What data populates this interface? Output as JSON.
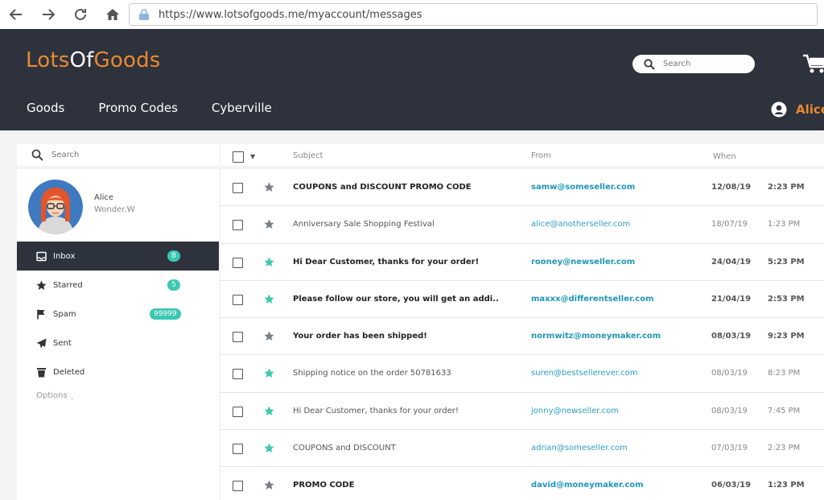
{
  "browser": {
    "url": "https://www.lotsofgoods.me/myaccount/messages"
  },
  "site": {
    "logo_part1": "Lots",
    "logo_part2": "Of",
    "logo_part3": "Goods",
    "search_placeholder": "Search",
    "nav": [
      "Goods",
      "Promo Codes",
      "Cyberville"
    ],
    "user_name": "Alice",
    "logo_color_orange": "#ea8a2f",
    "logo_color_white": "#ffffff"
  },
  "sidebar": {
    "search_placeholder": "Search",
    "profile_name": "Alice",
    "profile_sub": "Wonder.W",
    "folders": [
      {
        "label": "Inbox",
        "icon": "inbox-icon",
        "badge": "8",
        "active": true
      },
      {
        "label": "Starred",
        "icon": "star-icon",
        "badge": "5",
        "active": false
      },
      {
        "label": "Spam",
        "icon": "flag-icon",
        "badge": "99999",
        "active": false
      },
      {
        "label": "Sent",
        "icon": "paper-plane-icon",
        "badge": "",
        "active": false
      },
      {
        "label": "Deleted",
        "icon": "trash-icon",
        "badge": "",
        "active": false
      }
    ],
    "options_label": "Options ˏ"
  },
  "list": {
    "headers": {
      "subject": "Subject",
      "from": "From",
      "when": "When"
    },
    "messages": [
      {
        "subject": "COUPONS and DISCOUNT PROMO CODE",
        "from": "samw@someseller.com",
        "date": "12/08/19",
        "time": "2:23 PM",
        "unread": true,
        "starred": false
      },
      {
        "subject": "Anniversary Sale Shopping Festival",
        "from": "alice@anotherseller.com",
        "date": "18/07/19",
        "time": "1:23 PM",
        "unread": false,
        "starred": false
      },
      {
        "subject": "Hi Dear Customer, thanks for your order!",
        "from": "rooney@newseller.com",
        "date": "24/04/19",
        "time": "5:23 PM",
        "unread": true,
        "starred": true
      },
      {
        "subject": "Please follow our store, you will get an addi..",
        "from": "maxxx@differentseller.com",
        "date": "21/04/19",
        "time": "2:53 PM",
        "unread": true,
        "starred": true
      },
      {
        "subject": "Your order has been shipped!",
        "from": "normwitz@moneymaker.com",
        "date": "08/03/19",
        "time": "9:23 PM",
        "unread": true,
        "starred": false
      },
      {
        "subject": "Shipping notice on the order 50781633",
        "from": "suren@bestsellerever.com",
        "date": "08/03/19",
        "time": "8:23 PM",
        "unread": false,
        "starred": true
      },
      {
        "subject": "Hi Dear Customer, thanks for your order!",
        "from": "jonny@newseller.com",
        "date": "08/03/19",
        "time": "7:45 PM",
        "unread": false,
        "starred": true
      },
      {
        "subject": "COUPONS and DISCOUNT",
        "from": "adrian@someseller.com",
        "date": "07/03/19",
        "time": "2:23 PM",
        "unread": false,
        "starred": true
      },
      {
        "subject": "PROMO CODE",
        "from": "david@moneymaker.com",
        "date": "06/03/19",
        "time": "1:23 PM",
        "unread": true,
        "starred": false
      }
    ]
  },
  "colors": {
    "header_bg": "#2d323c",
    "accent_orange": "#ea8a2f",
    "badge_teal": "#3cc7b1",
    "star_teal": "#3cc7b1",
    "star_gray": "#7b7f88",
    "link_blue": "#2aa0c2"
  }
}
